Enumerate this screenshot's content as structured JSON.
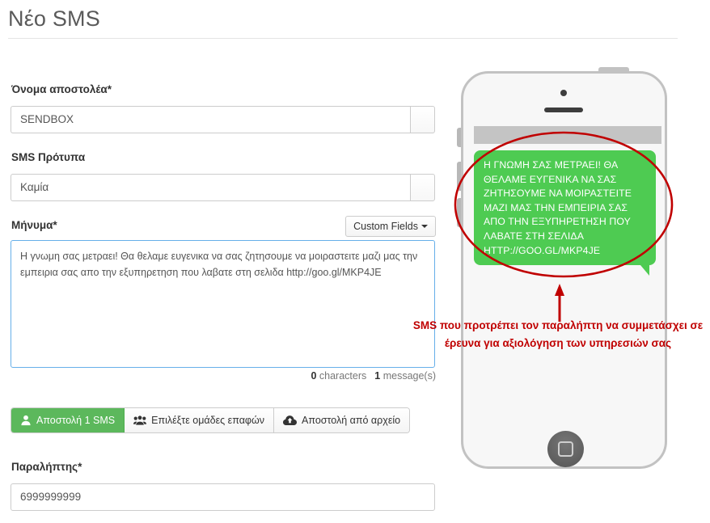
{
  "page": {
    "title": "Νέο SMS"
  },
  "form": {
    "sender": {
      "label": "Όνομα αποστολέα*",
      "value": "SENDBOX",
      "placeholder": "SENDBOX"
    },
    "template": {
      "label": "SMS Πρότυπα",
      "value": "Καμία",
      "placeholder": "Καμία"
    },
    "message": {
      "label": "Μήνυμα*",
      "custom_fields_button": "Custom Fields",
      "value": "Η γνωμη σας μετραει! Θα θελαμε ευγενικα να σας ζητησουμε να μοιραστειτε μαζι μας την εμπειρια σας απο την εξυπηρετηση που λαβατε στη σελιδα http://goo.gl/MKP4JE",
      "placeholder": ""
    },
    "counter": {
      "characters_count": "0",
      "characters_label": "characters",
      "messages_count": "1",
      "messages_label": "message(s)"
    },
    "buttons": [
      {
        "label": "Αποστολή 1 SMS",
        "icon": "user-icon",
        "active": true
      },
      {
        "label": "Επιλέξτε ομάδες επαφών",
        "icon": "users-group-icon",
        "active": false
      },
      {
        "label": "Αποστολή από αρχείο",
        "icon": "cloud-upload-icon",
        "active": false
      }
    ],
    "recipient": {
      "label": "Παραλήπτης*",
      "value": "6999999999",
      "placeholder": "6999999999"
    }
  },
  "preview": {
    "sms_text": "Η ΓΝΩΜΗ ΣΑΣ ΜΕΤΡΑΕΙ! ΘΑ ΘΕΛΑΜΕ ΕΥΓΕΝΙΚΑ ΝΑ ΣΑΣ ΖΗΤΗΣΟΥΜΕ ΝΑ ΜΟΙΡΑΣΤΕΙΤΕ ΜΑΖΙ ΜΑΣ ΤΗΝ ΕΜΠΕΙΡΙΑ ΣΑΣ ΑΠΟ ΤΗΝ ΕΞΥΠΗΡΕΤΗΣΗ ΠΟΥ ΛΑΒΑΤΕ ΣΤΗ ΣΕΛΙΔΑ HTTP://GOO.GL/MKP4JE"
  },
  "annotation": {
    "text": "SMS που προτρέπει τον παραλήπτη να συμμετάσχει σε έρευνα για αξιολόγηση των υπηρεσιών σας",
    "color": "#C00000"
  },
  "colors": {
    "accent_green": "#5cb85c",
    "bubble_green": "#4ECB52",
    "focus_blue": "#66afe9",
    "annotation_red": "#C00000"
  }
}
